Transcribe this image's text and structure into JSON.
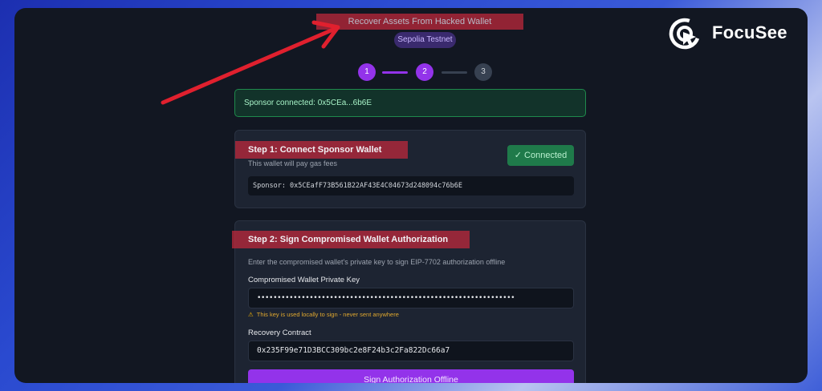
{
  "header": {
    "title": "Recover Assets From Hacked Wallet",
    "network": "Sepolia Testnet"
  },
  "stepper": {
    "steps": [
      "1",
      "2",
      "3"
    ],
    "current": 2
  },
  "alert": {
    "text": "Sponsor connected: 0x5CEa...6b6E"
  },
  "step1": {
    "title": "Step 1: Connect Sponsor Wallet",
    "subtitle": "This wallet will pay gas fees",
    "connected_label": "✓ Connected",
    "sponsor_address": "Sponsor: 0x5CEafF73B561B22AF43E4C04673d248094c76b6E"
  },
  "step2": {
    "title": "Step 2: Sign Compromised Wallet Authorization",
    "subtitle": "Enter the compromised wallet's private key to sign EIP-7702 authorization offline",
    "key_label": "Compromised Wallet Private Key",
    "key_value": "••••••••••••••••••••••••••••••••••••••••••••••••••••••••••••••••",
    "warning": "This key is used locally to sign - never sent anywhere",
    "contract_label": "Recovery Contract",
    "contract_value": "0x235F99e71D3BCC309bc2e8F24b3c2Fa822Dc66a7",
    "sign_button": "Sign Authorization Offline"
  },
  "watermark": {
    "brand": "FocuSee"
  },
  "colors": {
    "accent": "#9333ea",
    "success": "#1f7a4a",
    "highlight": "#c4283c",
    "annotation_arrow": "#e0202e"
  }
}
